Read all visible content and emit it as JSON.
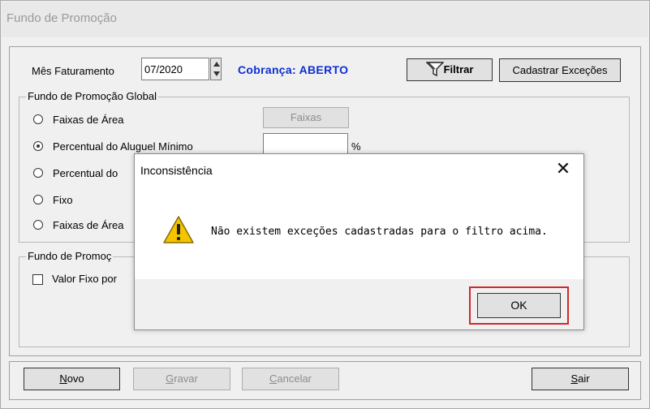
{
  "window": {
    "title": "Fundo de Promoção"
  },
  "filter": {
    "month_label": "Mês Faturamento",
    "month_value": "07/2020",
    "status_text": "Cobrança: ABERTO",
    "filter_button": "Filtrar",
    "register_exceptions_button": "Cadastrar Exceções"
  },
  "global_group": {
    "legend": "Fundo de Promoção Global",
    "options": [
      {
        "label": "Faixas de Área",
        "selected": false
      },
      {
        "label": "Percentual do Aluguel Mínimo",
        "selected": true
      },
      {
        "label": "Percentual do",
        "selected": false
      },
      {
        "label": "Fixo",
        "selected": false
      },
      {
        "label": "Faixas de Área",
        "selected": false
      }
    ],
    "faixas_button": "Faixas",
    "percent_symbol": "%"
  },
  "second_group": {
    "legend": "Fundo de Promoç",
    "checkbox_label": "Valor Fixo por"
  },
  "footer": {
    "novo_rest": "ovo",
    "novo_key": "N",
    "gravar_key": "G",
    "gravar_rest": "ravar",
    "cancelar_key": "C",
    "cancelar_rest": "ancelar",
    "sair_key": "S",
    "sair_rest": "air"
  },
  "dialog": {
    "title": "Inconsistência",
    "message": "Não existem exceções cadastradas para o filtro acima.",
    "ok_label": "OK",
    "highlight_color": "#d0282e"
  },
  "colors": {
    "status": "#0c2fd0"
  }
}
